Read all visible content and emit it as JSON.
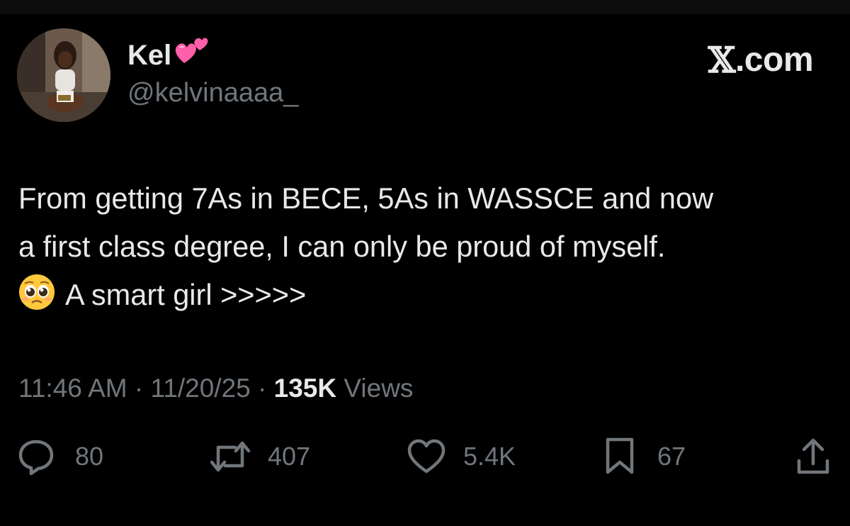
{
  "user": {
    "display_name": "Kel",
    "name_emoji_icon": "two-hearts-icon",
    "handle": "@kelvinaaaa_",
    "avatar_icon": "avatar-photo"
  },
  "brand": {
    "x_glyph": "𝕏",
    "suffix": ".com"
  },
  "tweet": {
    "line1": "From getting 7As in BECE, 5As in WASSCE and now",
    "line2": "a first class degree, I can only be proud of myself.",
    "line3_emoji_icon": "pleading-face-icon",
    "line3": "A smart girl >>>>>"
  },
  "meta": {
    "time": "11:46 AM",
    "separator": " · ",
    "date": "11/20/25",
    "views_count": "135K",
    "views_label": " Views"
  },
  "actions": {
    "replies": "80",
    "reposts": "407",
    "likes": "5.4K",
    "bookmarks": "67"
  },
  "colors": {
    "background": "#000000",
    "primary_text": "#e7e9ea",
    "secondary_text": "#71767b",
    "heart_pink": "#ff5fa8"
  }
}
